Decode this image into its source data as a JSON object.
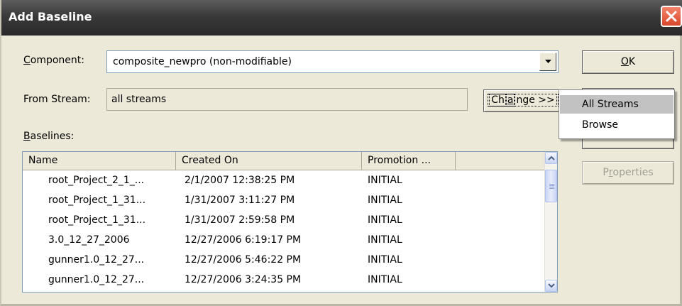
{
  "window": {
    "title": "Add Baseline"
  },
  "form": {
    "component_label": {
      "mnemonic": "C",
      "rest": "omponent:"
    },
    "component_value": "composite_newpro   (non-modifiable)",
    "from_stream_label": "From Stream:",
    "from_stream_value": "all streams",
    "change_button": {
      "pre": "Ch",
      "mnemonic": "a",
      "post": "nge >>"
    },
    "baselines_label": {
      "mnemonic": "B",
      "rest": "aselines:"
    }
  },
  "buttons": {
    "ok": {
      "mnemonic": "O",
      "rest": "K"
    },
    "properties": {
      "pre": "P",
      "mnemonic": "r",
      "post": "operties"
    }
  },
  "table": {
    "columns": [
      "Name",
      "Created On",
      "Promotion ...",
      ""
    ],
    "rows": [
      {
        "name": "root_Project_2_1_...",
        "created": "2/1/2007 12:38:25 PM",
        "promotion": "INITIAL"
      },
      {
        "name": "root_Project_1_31...",
        "created": "1/31/2007 3:11:27 PM",
        "promotion": "INITIAL"
      },
      {
        "name": "root_Project_1_31...",
        "created": "1/31/2007 2:59:58 PM",
        "promotion": "INITIAL"
      },
      {
        "name": "3.0_12_27_2006",
        "created": "12/27/2006 6:19:17 PM",
        "promotion": "INITIAL"
      },
      {
        "name": "gunner1.0_12_27...",
        "created": "12/27/2006 5:46:22 PM",
        "promotion": "INITIAL"
      },
      {
        "name": "gunner1.0_12_27...",
        "created": "12/27/2006 3:24:35 PM",
        "promotion": "INITIAL"
      }
    ]
  },
  "menu": {
    "items": [
      "All Streams",
      "Browse"
    ],
    "highlighted": "All Streams"
  },
  "icons": {
    "close": "close-icon",
    "dropdown": "chevron-down-icon",
    "scroll_up": "chevron-up-icon",
    "scroll_down": "chevron-down-icon"
  },
  "colors": {
    "dialog_bg": "#ece9d8",
    "title_bar": "#3a3a3a",
    "close_button": "#e0553a",
    "menu_highlight": "#c2c2c2",
    "disabled_text": "#a09f93"
  }
}
